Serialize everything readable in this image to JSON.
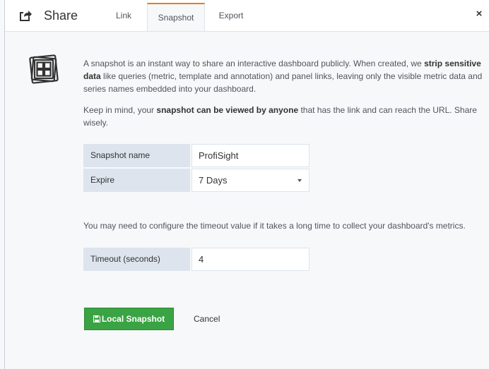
{
  "header": {
    "title": "Share",
    "tabs": [
      {
        "label": "Link",
        "active": false
      },
      {
        "label": "Snapshot",
        "active": true
      },
      {
        "label": "Export",
        "active": false
      }
    ],
    "close_symbol": "×"
  },
  "description": {
    "p1_a": "A snapshot is an instant way to share an interactive dashboard publicly. When created, we ",
    "p1_b": "strip sensitive data",
    "p1_c": " like queries (metric, template and annotation) and panel links, leaving only the visible metric data and series names embedded into your dashboard.",
    "p2_a": "Keep in mind, your ",
    "p2_b": "snapshot can be viewed by anyone",
    "p2_c": " that has the link and can reach the URL. Share wisely."
  },
  "form": {
    "snapshot_name_label": "Snapshot name",
    "snapshot_name_value": "ProfiSight",
    "expire_label": "Expire",
    "expire_value": "7 Days"
  },
  "timeout_note": "You may need to configure the timeout value if it takes a long time to collect your dashboard's metrics.",
  "timeout": {
    "label": "Timeout (seconds)",
    "value": "4"
  },
  "actions": {
    "local_snapshot_label": "Local Snapshot",
    "cancel_label": "Cancel"
  },
  "icons": {
    "header": "share-arrow-icon",
    "snapshot": "snapshot-stack-icon",
    "save": "save-icon"
  },
  "colors": {
    "accent_tab": "#eb7b18",
    "primary_button": "#3aa343",
    "label_bg": "#dde4ed"
  }
}
